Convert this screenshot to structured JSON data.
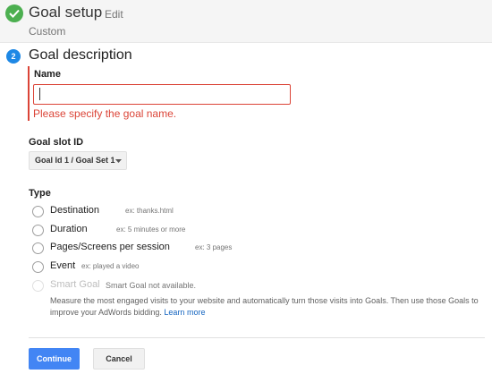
{
  "goal_setup": {
    "title": "Goal setup",
    "edit_label": "Edit",
    "subtitle": "Custom",
    "status_icon": "check-icon"
  },
  "goal_description": {
    "step_number": "2",
    "title": "Goal description",
    "name_label": "Name",
    "name_value": "",
    "name_error": "Please specify the goal name."
  },
  "goal_slot": {
    "label": "Goal slot ID",
    "selected": "Goal Id 1 / Goal Set 1"
  },
  "type": {
    "label": "Type",
    "options": [
      {
        "label": "Destination",
        "example": "ex: thanks.html",
        "enabled": true
      },
      {
        "label": "Duration",
        "example": "ex: 5 minutes or more",
        "enabled": true
      },
      {
        "label": "Pages/Screens per session",
        "example": "ex: 3 pages",
        "enabled": true
      },
      {
        "label": "Event",
        "example": "ex: played a video",
        "enabled": true
      }
    ],
    "smart_goal": {
      "label": "Smart Goal",
      "note": "Smart Goal not available.",
      "description": "Measure the most engaged visits to your website and automatically turn those visits into Goals. Then use those Goals to improve your AdWords bidding.",
      "learn_more": "Learn more",
      "enabled": false
    }
  },
  "actions": {
    "continue_label": "Continue",
    "cancel_label": "Cancel"
  },
  "colors": {
    "accent": "#4285f4",
    "error": "#db4437",
    "success": "#4caf50",
    "step_badge": "#1e88e5"
  }
}
